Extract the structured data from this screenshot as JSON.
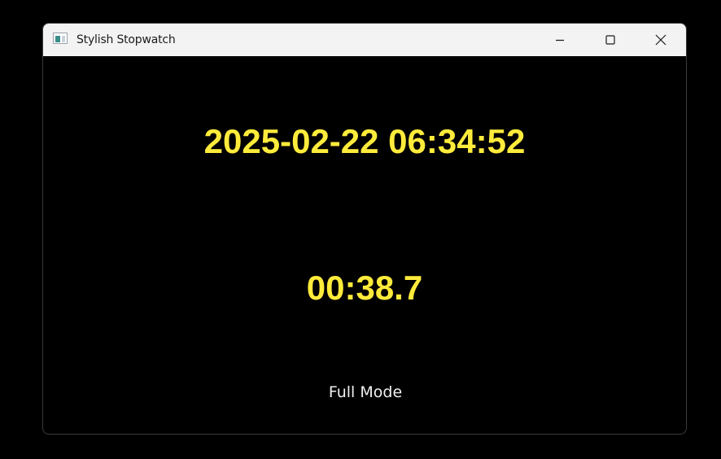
{
  "window": {
    "title": "Stylish Stopwatch",
    "app_icon": "window-app-icon",
    "controls": {
      "minimize_icon": "minimize-icon",
      "maximize_icon": "maximize-icon",
      "close_icon": "close-icon"
    }
  },
  "display": {
    "datetime": "2025-02-22 06:34:52",
    "elapsed": "00:38.7",
    "text_color": "#ffeb3b",
    "background": "#000000"
  },
  "mode_button": {
    "label": "Full Mode"
  }
}
